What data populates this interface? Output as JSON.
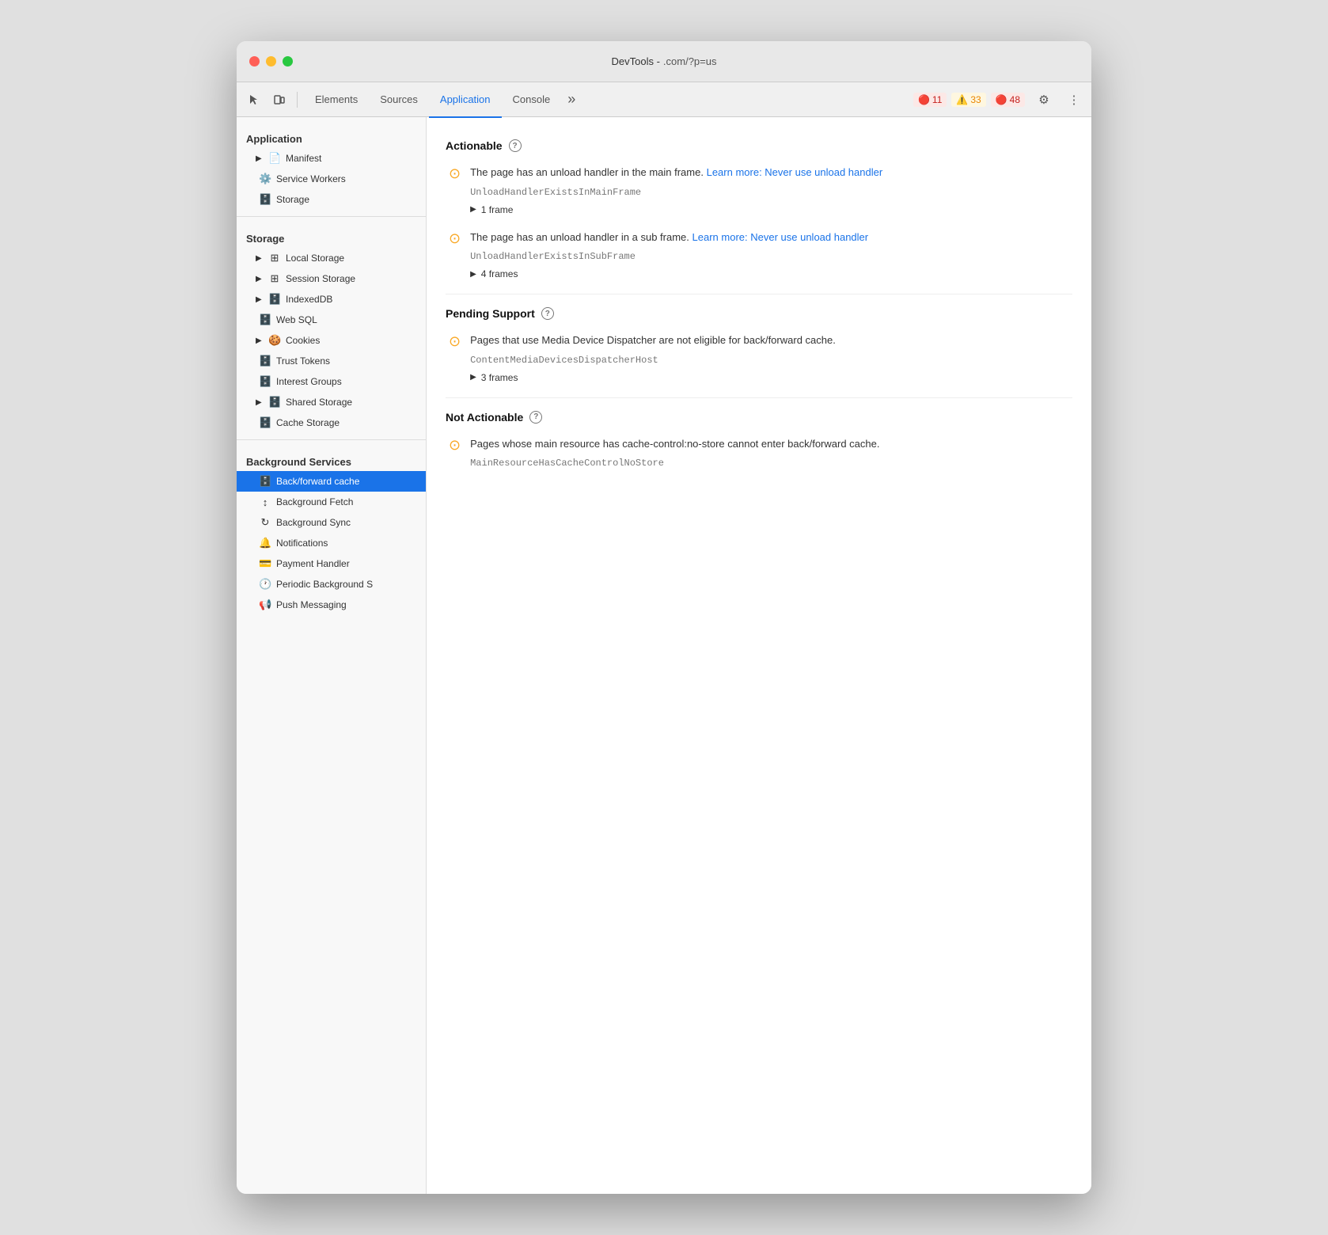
{
  "window": {
    "title": "DevTools -",
    "url": ".com/?p=us"
  },
  "toolbar": {
    "elements_tab": "Elements",
    "sources_tab": "Sources",
    "application_tab": "Application",
    "console_tab": "Console",
    "more_tabs": "»",
    "error_count": "11",
    "warning_count": "33",
    "issue_count": "48",
    "settings_icon": "⚙",
    "more_icon": "⋮"
  },
  "sidebar": {
    "application_label": "Application",
    "manifest_item": "Manifest",
    "service_workers_item": "Service Workers",
    "storage_item": "Storage",
    "storage_label": "Storage",
    "local_storage_item": "Local Storage",
    "session_storage_item": "Session Storage",
    "indexeddb_item": "IndexedDB",
    "web_sql_item": "Web SQL",
    "cookies_item": "Cookies",
    "trust_tokens_item": "Trust Tokens",
    "interest_groups_item": "Interest Groups",
    "shared_storage_item": "Shared Storage",
    "cache_storage_item": "Cache Storage",
    "background_services_label": "Background Services",
    "back_forward_cache_item": "Back/forward cache",
    "background_fetch_item": "Background Fetch",
    "background_sync_item": "Background Sync",
    "notifications_item": "Notifications",
    "payment_handler_item": "Payment Handler",
    "periodic_background_item": "Periodic Background S",
    "push_messaging_item": "Push Messaging"
  },
  "main": {
    "actionable_title": "Actionable",
    "actionable_help": "?",
    "issue1_text": "The page has an unload handler in the main frame.",
    "issue1_link": "Learn more: Never use unload handler",
    "issue1_code": "UnloadHandlerExistsInMainFrame",
    "issue1_frames": "1 frame",
    "issue2_text": "The page has an unload handler in a sub frame.",
    "issue2_link": "Learn more: Never use unload handler",
    "issue2_code": "UnloadHandlerExistsInSubFrame",
    "issue2_frames": "4 frames",
    "pending_support_title": "Pending Support",
    "pending_support_help": "?",
    "issue3_text": "Pages that use Media Device Dispatcher are not eligible for back/forward cache.",
    "issue3_code": "ContentMediaDevicesDispatcherHost",
    "issue3_frames": "3 frames",
    "not_actionable_title": "Not Actionable",
    "not_actionable_help": "?",
    "issue4_text": "Pages whose main resource has cache-control:no-store cannot enter back/forward cache.",
    "issue4_code": "MainResourceHasCacheControlNoStore"
  }
}
